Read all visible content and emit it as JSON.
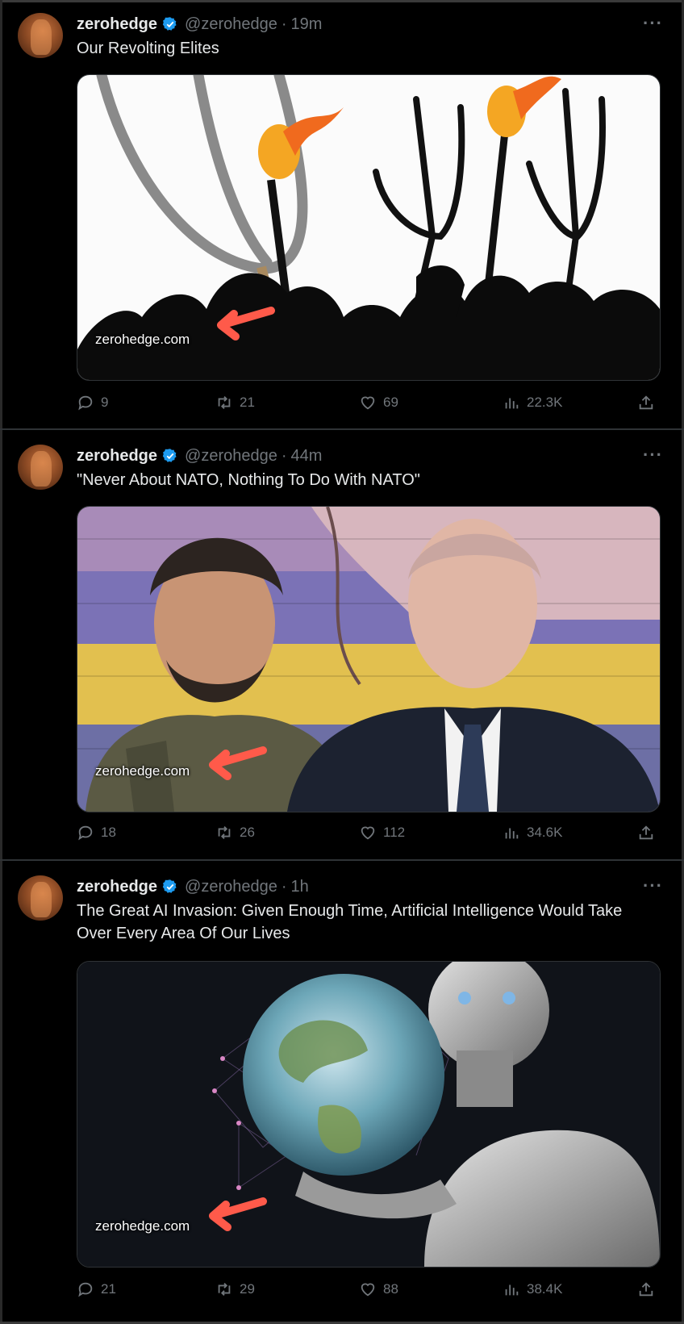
{
  "tweets": [
    {
      "name": "zerohedge",
      "handle": "@zerohedge",
      "separator": "·",
      "time": "19m",
      "text": "Our Revolting Elites",
      "media_domain": "zerohedge.com",
      "replies": "9",
      "retweets": "21",
      "likes": "69",
      "views": "22.3K"
    },
    {
      "name": "zerohedge",
      "handle": "@zerohedge",
      "separator": "·",
      "time": "44m",
      "text": "\"Never About NATO, Nothing To Do With NATO\"",
      "media_domain": "zerohedge.com",
      "replies": "18",
      "retweets": "26",
      "likes": "112",
      "views": "34.6K"
    },
    {
      "name": "zerohedge",
      "handle": "@zerohedge",
      "separator": "·",
      "time": "1h",
      "text": "The Great AI Invasion: Given Enough Time, Artificial Intelligence Would Take Over Every Area Of Our Lives",
      "media_domain": "zerohedge.com",
      "replies": "21",
      "retweets": "29",
      "likes": "88",
      "views": "38.4K"
    }
  ],
  "icons": {
    "verified": "verified-badge-icon",
    "more": "more-icon",
    "reply": "reply-icon",
    "retweet": "retweet-icon",
    "like": "heart-icon",
    "views": "views-icon",
    "share": "share-icon"
  },
  "colors": {
    "background": "#000000",
    "verified": "#1d9bf0",
    "secondary_text": "#71767b",
    "annotation_arrow": "#ff5a4a"
  }
}
